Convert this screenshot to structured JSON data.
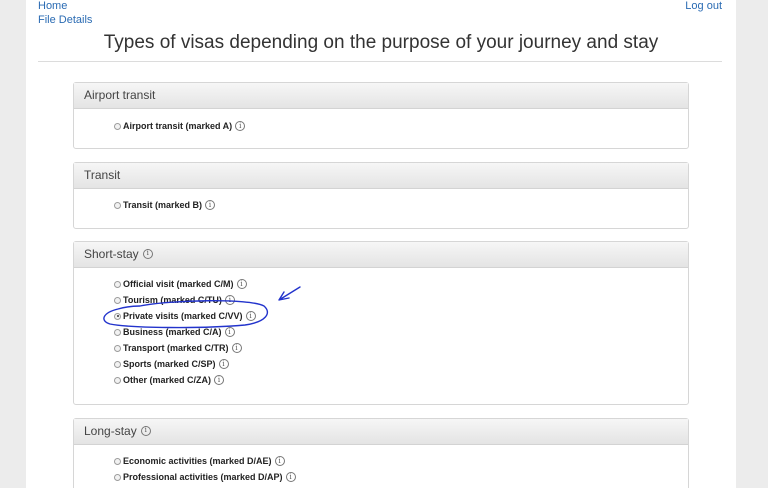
{
  "nav": {
    "home": "Home",
    "file_details": "File Details",
    "logout": "Log out"
  },
  "title": "Types of visas depending on the purpose of your journey and stay",
  "info_glyph": "i",
  "sections": [
    {
      "title": "Airport transit",
      "options": [
        {
          "label": "Airport transit (marked A)",
          "checked": false
        }
      ]
    },
    {
      "title": "Transit",
      "options": [
        {
          "label": "Transit (marked B)",
          "checked": false
        }
      ]
    },
    {
      "title": "Short-stay",
      "options": [
        {
          "label": "Official visit (marked C/M)",
          "checked": false
        },
        {
          "label": "Tourism (marked C/TU)",
          "checked": false
        },
        {
          "label": "Private visits (marked C/VV)",
          "checked": true
        },
        {
          "label": "Business (marked C/A)",
          "checked": false
        },
        {
          "label": "Transport (marked C/TR)",
          "checked": false
        },
        {
          "label": "Sports (marked C/SP)",
          "checked": false
        },
        {
          "label": "Other (marked C/ZA)",
          "checked": false
        }
      ]
    },
    {
      "title": "Long-stay",
      "options": [
        {
          "label": "Economic activities (marked D/AE)",
          "checked": false
        },
        {
          "label": "Professional activities (marked D/AP)",
          "checked": false
        }
      ]
    }
  ],
  "colors": {
    "link": "#2a6bb3",
    "annotation_ink": "#2233cc"
  }
}
